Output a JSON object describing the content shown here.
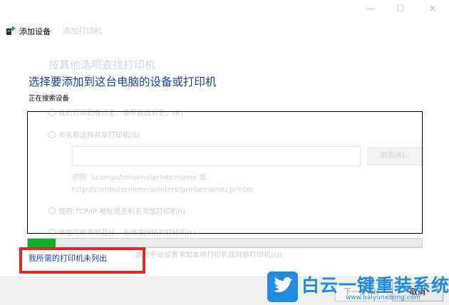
{
  "window": {
    "title": "添加设备",
    "minimize_glyph": "—",
    "maximize_glyph": "☐",
    "close_glyph": "✕"
  },
  "ghost_window": {
    "back_glyph": "←",
    "title": "添加打印机",
    "heading": "按其他选项查找打印机",
    "options": [
      "我的打印机有点老。请帮我找到它。(R)",
      "按名称选择共享打印机(S)",
      "使用 TCP/IP 地址或主机名添加打印机(I)",
      "添加可检测到蓝牙、无线或网络的打印机(L)",
      "通过手动设置添加本地打印机或网络打印机(O)"
    ],
    "browse_label": "浏览(R)...",
    "example_line1": "示例: \\\\computername\\printername 或",
    "example_line2": "http://computername/printers/printername/.printer"
  },
  "main": {
    "heading": "选择要添加到这台电脑的设备或打印机",
    "status_text": "正在搜索设备",
    "progress": 0.07,
    "not_listed_link": "我所需的打印机未列出"
  },
  "footer": {
    "next_label": "下一步(N)",
    "cancel_label": "取消"
  },
  "watermark": {
    "brand": "白云一键重装系统",
    "url": "www.baiyunxitong.com"
  },
  "colors": {
    "heading": "#1f3c8c",
    "link": "#0e49b5",
    "progress_fill": "#06b025",
    "highlight": "#e22727",
    "watermark": "#1e8be0"
  }
}
